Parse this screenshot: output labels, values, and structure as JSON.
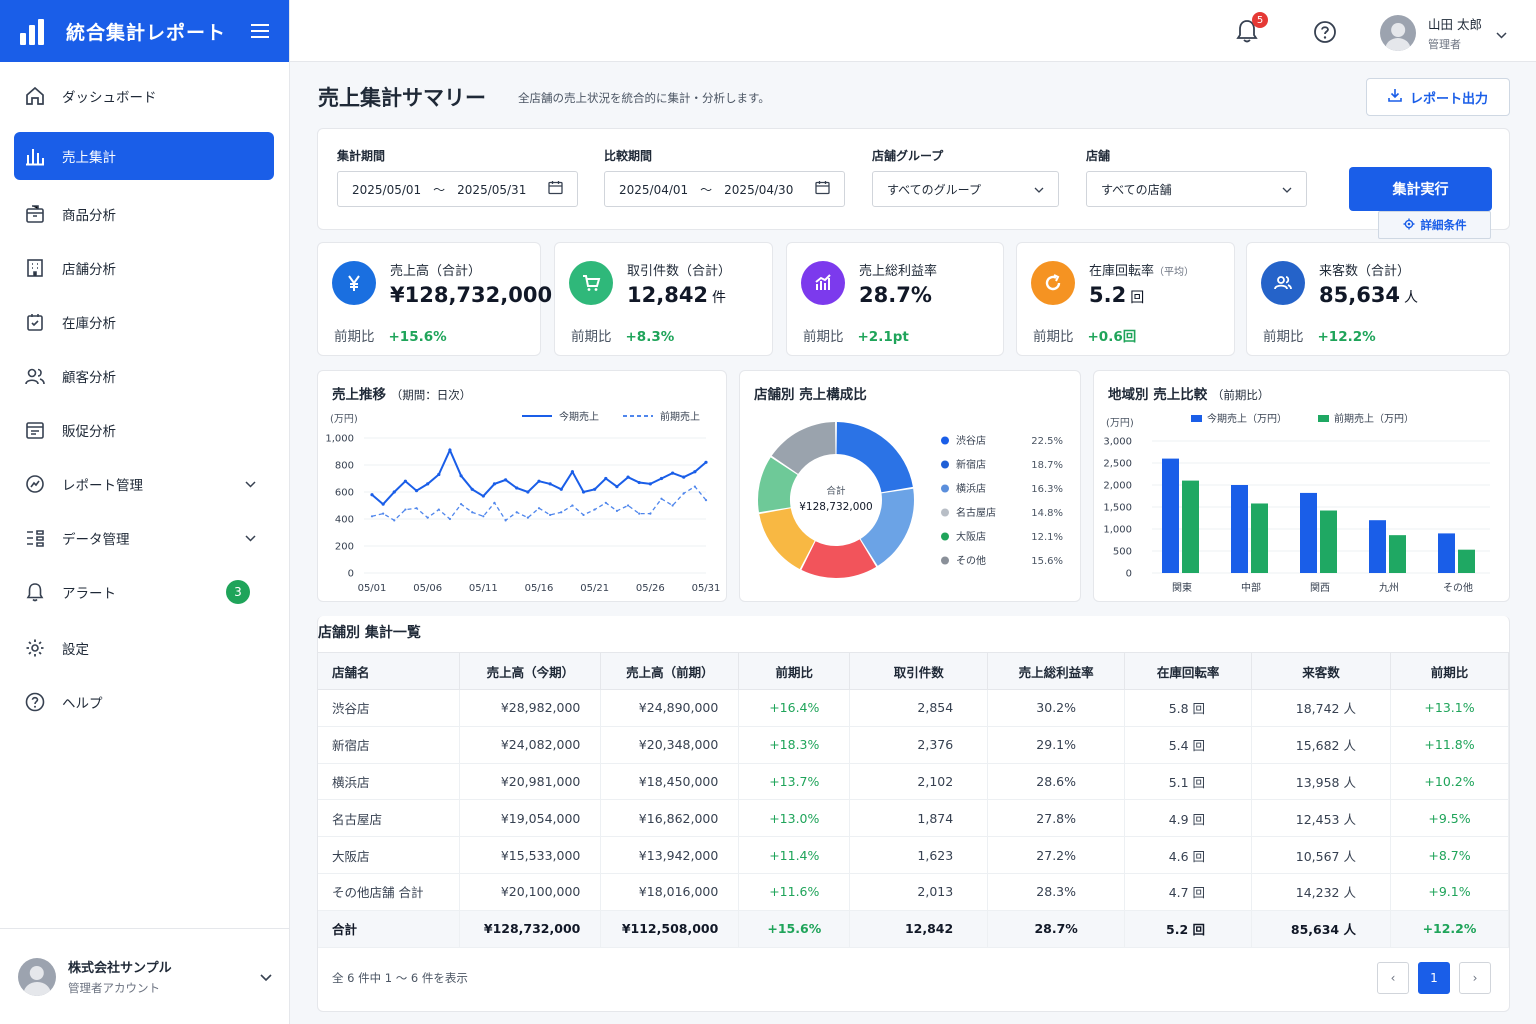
{
  "app": {
    "title": "統合集計レポート",
    "menu_icon": "hamburger-icon"
  },
  "sidebar": {
    "items": [
      {
        "label": "ダッシュボード",
        "icon": "home-icon"
      },
      {
        "label": "売上集計",
        "icon": "bar-chart-icon",
        "active": true
      },
      {
        "label": "商品分析",
        "icon": "box-icon"
      },
      {
        "label": "店舗分析",
        "icon": "building-icon"
      },
      {
        "label": "在庫分析",
        "icon": "inventory-icon"
      },
      {
        "label": "顧客分析",
        "icon": "users-icon"
      },
      {
        "label": "販促分析",
        "icon": "campaign-icon"
      },
      {
        "label": "レポート管理",
        "icon": "report-icon",
        "expandable": true
      },
      {
        "label": "データ管理",
        "icon": "data-icon",
        "expandable": true
      },
      {
        "label": "アラート",
        "icon": "bell-icon",
        "badge": "3"
      },
      {
        "label": "設定",
        "icon": "gear-icon"
      },
      {
        "label": "ヘルプ",
        "icon": "help-icon"
      }
    ],
    "account": {
      "name": "株式会社サンプル",
      "role": "管理者アカウント"
    }
  },
  "header": {
    "notification_count": "5",
    "user": {
      "name": "山田 太郎",
      "role": "管理者"
    }
  },
  "page": {
    "title": "売上集計サマリー",
    "subtitle": "全店舗の売上状況を統合的に集計・分析します。",
    "export_label": "レポート出力"
  },
  "filters": {
    "period": {
      "label": "集計期間",
      "value": "2025/05/01　～　2025/05/31"
    },
    "compare": {
      "label": "比較期間",
      "value": "2025/04/01　～　2025/04/30"
    },
    "group": {
      "label": "店舗グループ",
      "value": "すべてのグループ"
    },
    "store": {
      "label": "店舗",
      "value": "すべての店舗"
    },
    "run_label": "集計実行",
    "detail_label": "詳細条件"
  },
  "kpis": [
    {
      "label": "売上高（合計）",
      "note": "",
      "value": "¥128,732,000",
      "unit": "",
      "cmp_label": "前期比",
      "cmp_value": "+15.6%",
      "color": "#1a6fe0",
      "icon": "yen-icon"
    },
    {
      "label": "取引件数（合計）",
      "note": "",
      "value": "12,842",
      "unit": "件",
      "cmp_label": "前期比",
      "cmp_value": "+8.3%",
      "color": "#2fb87a",
      "icon": "cart-icon"
    },
    {
      "label": "売上総利益率",
      "note": "",
      "value": "28.7%",
      "unit": "",
      "cmp_label": "前期比",
      "cmp_value": "+2.1pt",
      "color": "#7c3aed",
      "icon": "profit-chart-icon"
    },
    {
      "label": "在庫回転率",
      "note": "（平均）",
      "value": "5.2",
      "unit": "回",
      "cmp_label": "前期比",
      "cmp_value": "+0.6回",
      "color": "#f59322",
      "icon": "refresh-icon"
    },
    {
      "label": "来客数（合計）",
      "note": "",
      "value": "85,634",
      "unit": "人",
      "cmp_label": "前期比",
      "cmp_value": "+12.2%",
      "color": "#2563c9",
      "icon": "visitors-icon"
    }
  ],
  "charts": {
    "trend_title": "売上推移",
    "trend_note": "（期間：日次）",
    "share_title": "店舗別 売上構成比",
    "share_center_label": "合計",
    "share_center_value": "¥128,732,000",
    "region_title": "地域別 売上比較",
    "region_note": "（前期比）"
  },
  "chart_data": [
    {
      "type": "line",
      "ylabel": "(万円)",
      "ylim": [
        0,
        1000
      ],
      "yticks": [
        0,
        200,
        400,
        600,
        800,
        1000
      ],
      "xticks": [
        "05/01",
        "05/06",
        "05/11",
        "05/16",
        "05/21",
        "05/26",
        "05/31"
      ],
      "series": [
        {
          "name": "今期売上",
          "color": "#1a5ee8",
          "dashed": false,
          "values": [
            580,
            510,
            600,
            680,
            610,
            660,
            730,
            910,
            720,
            620,
            570,
            660,
            690,
            630,
            600,
            680,
            660,
            620,
            750,
            600,
            620,
            700,
            640,
            710,
            670,
            660,
            700,
            740,
            710,
            750,
            820
          ]
        },
        {
          "name": "前期売上",
          "color": "#4f86ec",
          "dashed": true,
          "values": [
            420,
            440,
            390,
            470,
            480,
            410,
            470,
            400,
            510,
            450,
            420,
            520,
            390,
            450,
            410,
            480,
            430,
            450,
            500,
            430,
            470,
            520,
            460,
            500,
            440,
            440,
            550,
            500,
            590,
            640,
            540
          ]
        }
      ]
    },
    {
      "type": "pie",
      "categories": [
        "渋谷店",
        "新宿店",
        "横浜店",
        "名古屋店",
        "大阪店",
        "その他"
      ],
      "values": [
        22.5,
        18.7,
        16.3,
        14.8,
        12.1,
        15.6
      ],
      "labels": [
        "22.5%",
        "18.7%",
        "16.3%",
        "14.8%",
        "12.1%",
        "15.6%"
      ],
      "colors": [
        "#2b73e6",
        "#6ba3e6",
        "#f2545b",
        "#f8b843",
        "#6ec998",
        "#9aa3ad"
      ],
      "legend_colors": [
        "#1a5ee8",
        "#1f5fd6",
        "#5b8fdc",
        "#b8bec6",
        "#1fa45a",
        "#8a9099"
      ]
    },
    {
      "type": "bar",
      "ylabel": "(万円)",
      "ylim": [
        0,
        3000
      ],
      "yticks": [
        0,
        500,
        1000,
        1500,
        2000,
        2500,
        3000
      ],
      "categories": [
        "関東",
        "中部",
        "関西",
        "九州",
        "その他"
      ],
      "series": [
        {
          "name": "今期売上（万円）",
          "color": "#1a5ee8",
          "values": [
            2600,
            2000,
            1820,
            1200,
            900
          ]
        },
        {
          "name": "前期売上（万円）",
          "color": "#1fa863",
          "values": [
            2100,
            1580,
            1420,
            860,
            530
          ]
        }
      ]
    }
  ],
  "table": {
    "title": "店舗別 集計一覧",
    "headers": [
      "店舗名",
      "売上高（今期）",
      "売上高（前期）",
      "前期比",
      "取引件数",
      "売上総利益率",
      "在庫回転率",
      "来客数",
      "前期比"
    ],
    "rows": [
      [
        "渋谷店",
        "¥28,982,000",
        "¥24,890,000",
        "+16.4%",
        "2,854",
        "30.2%",
        "5.8 回",
        "18,742 人",
        "+13.1%"
      ],
      [
        "新宿店",
        "¥24,082,000",
        "¥20,348,000",
        "+18.3%",
        "2,376",
        "29.1%",
        "5.4 回",
        "15,682 人",
        "+11.8%"
      ],
      [
        "横浜店",
        "¥20,981,000",
        "¥18,450,000",
        "+13.7%",
        "2,102",
        "28.6%",
        "5.1 回",
        "13,958 人",
        "+10.2%"
      ],
      [
        "名古屋店",
        "¥19,054,000",
        "¥16,862,000",
        "+13.0%",
        "1,874",
        "27.8%",
        "4.9 回",
        "12,453 人",
        "+9.5%"
      ],
      [
        "大阪店",
        "¥15,533,000",
        "¥13,942,000",
        "+11.4%",
        "1,623",
        "27.2%",
        "4.6 回",
        "10,567 人",
        "+8.7%"
      ],
      [
        "その他店舗 合計",
        "¥20,100,000",
        "¥18,016,000",
        "+11.6%",
        "2,013",
        "28.3%",
        "4.7 回",
        "14,232 人",
        "+9.1%"
      ]
    ],
    "total": [
      "合計",
      "¥128,732,000",
      "¥112,508,000",
      "+15.6%",
      "12,842",
      "28.7%",
      "5.2 回",
      "85,634 人",
      "+12.2%"
    ],
    "footer": "全 6 件中 1 ～ 6 件を表示",
    "page": "1",
    "prev": "‹",
    "next": "›"
  },
  "colors": {
    "primary": "#1a5ee8",
    "positive": "#1fa45a",
    "alert": "#e53935"
  }
}
